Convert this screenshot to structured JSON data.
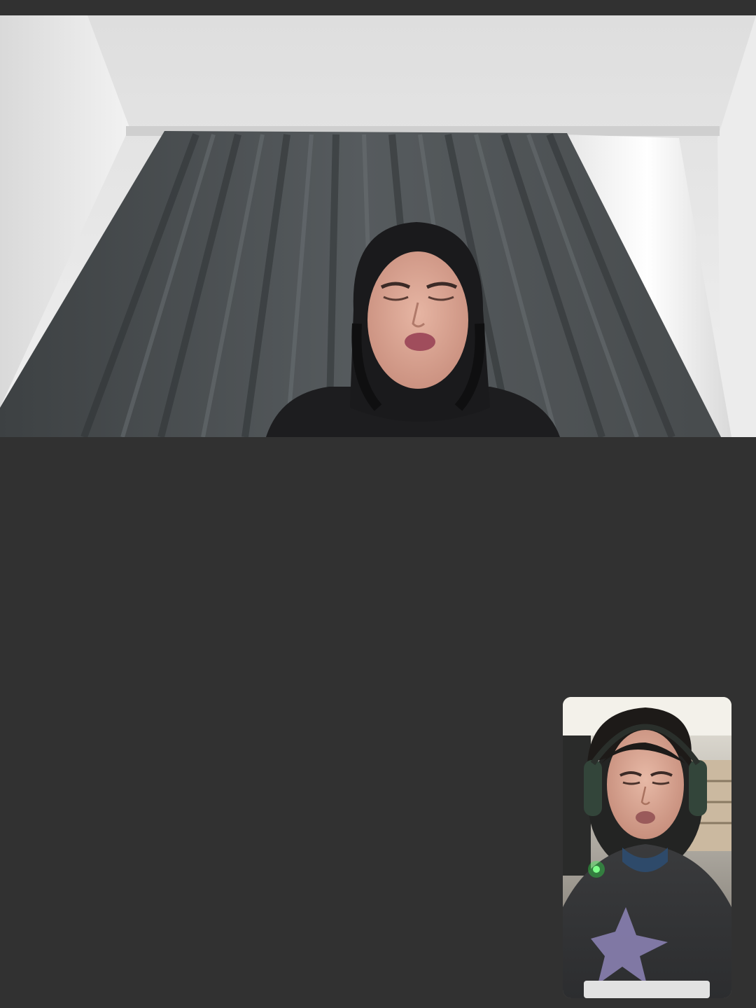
{
  "call": {
    "remote_participant": {
      "feed_description_icon": "remote-camera-feed"
    },
    "self_view": {
      "feed_description_icon": "self-camera-feed"
    }
  },
  "colors": {
    "background": "#313131",
    "curtain": "#4c5052",
    "wall": "#e8e8e8",
    "window_light": "#f4f4f0",
    "headset_led": "#2dff4a"
  }
}
